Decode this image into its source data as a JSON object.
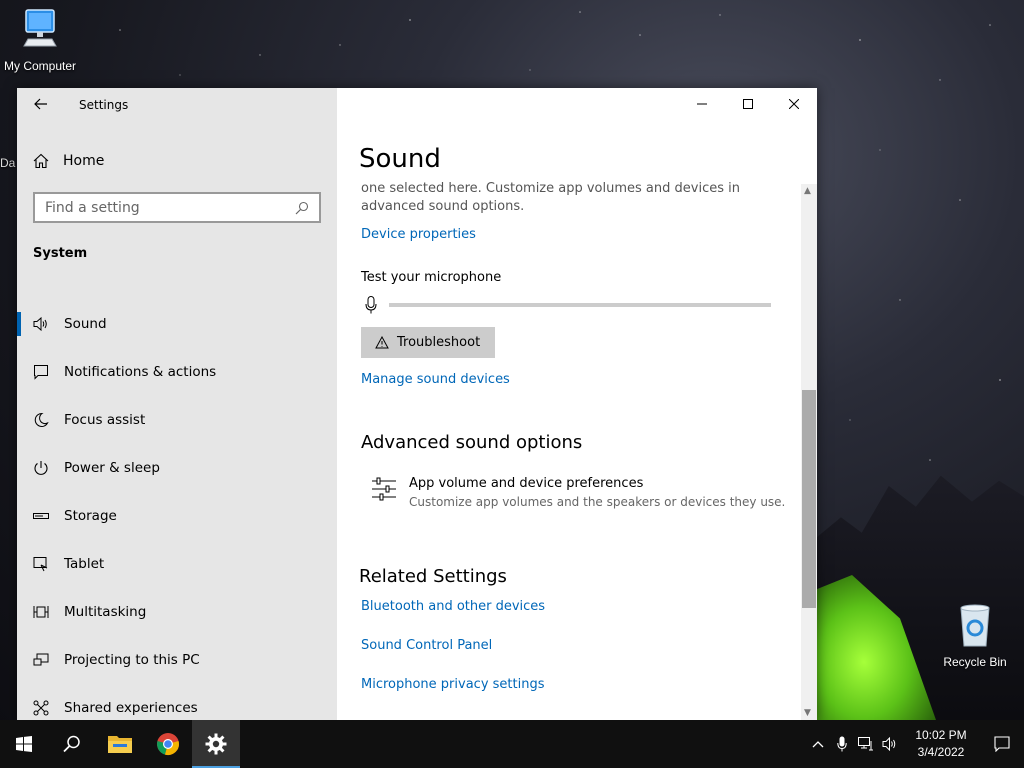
{
  "desktop": {
    "icons": [
      {
        "label": "My Computer",
        "icon": "computer-icon"
      },
      {
        "label": "Recycle Bin",
        "icon": "recycle-bin-icon"
      }
    ],
    "partial_label": "Da"
  },
  "window": {
    "title": "Settings",
    "controls": [
      "minimize-icon",
      "maximize-icon",
      "close-icon"
    ]
  },
  "sidebar": {
    "home_label": "Home",
    "search_placeholder": "Find a setting",
    "section_label": "System",
    "items": [
      {
        "label": "Sound",
        "icon": "speaker-icon",
        "active": true
      },
      {
        "label": "Notifications & actions",
        "icon": "notification-icon",
        "active": false
      },
      {
        "label": "Focus assist",
        "icon": "moon-icon",
        "active": false
      },
      {
        "label": "Power & sleep",
        "icon": "power-icon",
        "active": false
      },
      {
        "label": "Storage",
        "icon": "storage-icon",
        "active": false
      },
      {
        "label": "Tablet",
        "icon": "tablet-icon",
        "active": false
      },
      {
        "label": "Multitasking",
        "icon": "multitasking-icon",
        "active": false
      },
      {
        "label": "Projecting to this PC",
        "icon": "projecting-icon",
        "active": false
      },
      {
        "label": "Shared experiences",
        "icon": "shared-icon",
        "active": false
      }
    ]
  },
  "content": {
    "title": "Sound",
    "description": "one selected here. Customize app volumes and devices in advanced sound options.",
    "device_properties": "Device properties",
    "test_mic_label": "Test your microphone",
    "mic_level": 0,
    "troubleshoot_label": "Troubleshoot",
    "manage_devices": "Manage sound devices",
    "advanced_heading": "Advanced sound options",
    "app_volume_title": "App volume and device preferences",
    "app_volume_desc": "Customize app volumes and the speakers or devices they use.",
    "related_heading": "Related Settings",
    "related_links": [
      "Bluetooth and other devices",
      "Sound Control Panel",
      "Microphone privacy settings"
    ]
  },
  "taskbar": {
    "apps": [
      "start-icon",
      "search-icon",
      "file-explorer-icon",
      "chrome-icon",
      "settings-icon"
    ],
    "tray_icons": [
      "chevron-up-icon",
      "microphone-icon",
      "network-icon",
      "volume-icon"
    ],
    "time": "10:02 PM",
    "date": "3/4/2022"
  },
  "colors": {
    "accent": "#0063b1",
    "link": "#0067b8",
    "sidebar_bg": "#e6e6e6"
  }
}
